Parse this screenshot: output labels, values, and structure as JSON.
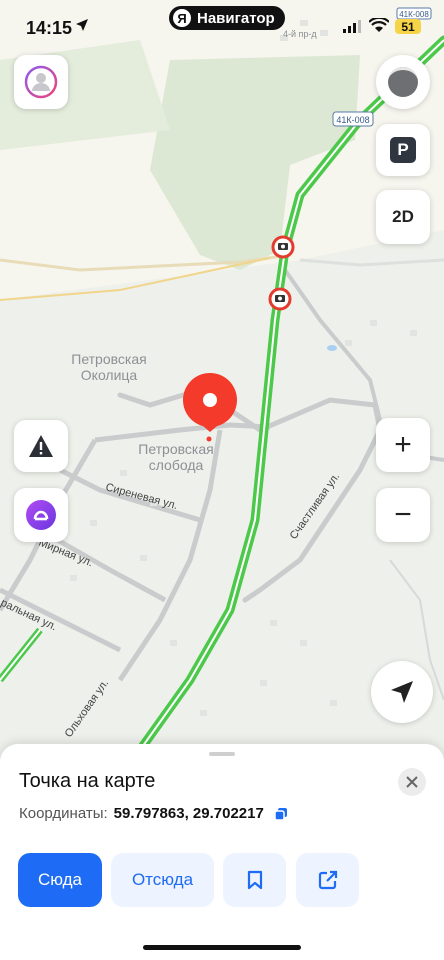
{
  "status_bar": {
    "time": "14:15",
    "app_name": "Навигатор",
    "battery": "51"
  },
  "map": {
    "road_badge": "41К-008",
    "road_badge_small": "41К-008",
    "street_fragment": "4-й пр-д",
    "places": [
      {
        "line1": "Петровская",
        "line2": "Околица"
      },
      {
        "line1": "Петровская",
        "line2": "слобода"
      }
    ],
    "streets": {
      "sirenevaya": "Сиреневая ул.",
      "mirnaya": "Мирная ул.",
      "centralnaya": "ральная ул.",
      "olkhovaya": "Ольховая ул.",
      "schastlivaya": "Счастливая ул."
    },
    "colors": {
      "traffic_green": "#4cc94a",
      "pin": "#f33a2b",
      "road": "#c9cbcc",
      "field": "#f6f5ee",
      "forest": "#dce8d4"
    }
  },
  "controls": {
    "view_mode": "2D",
    "parking": "P",
    "zoom_in": "+",
    "zoom_out": "−"
  },
  "sheet": {
    "title": "Точка на карте",
    "coords_label": "Координаты:",
    "coords_value": "59.797863, 29.702217",
    "btn_here": "Сюда",
    "btn_from": "Отсюда"
  }
}
